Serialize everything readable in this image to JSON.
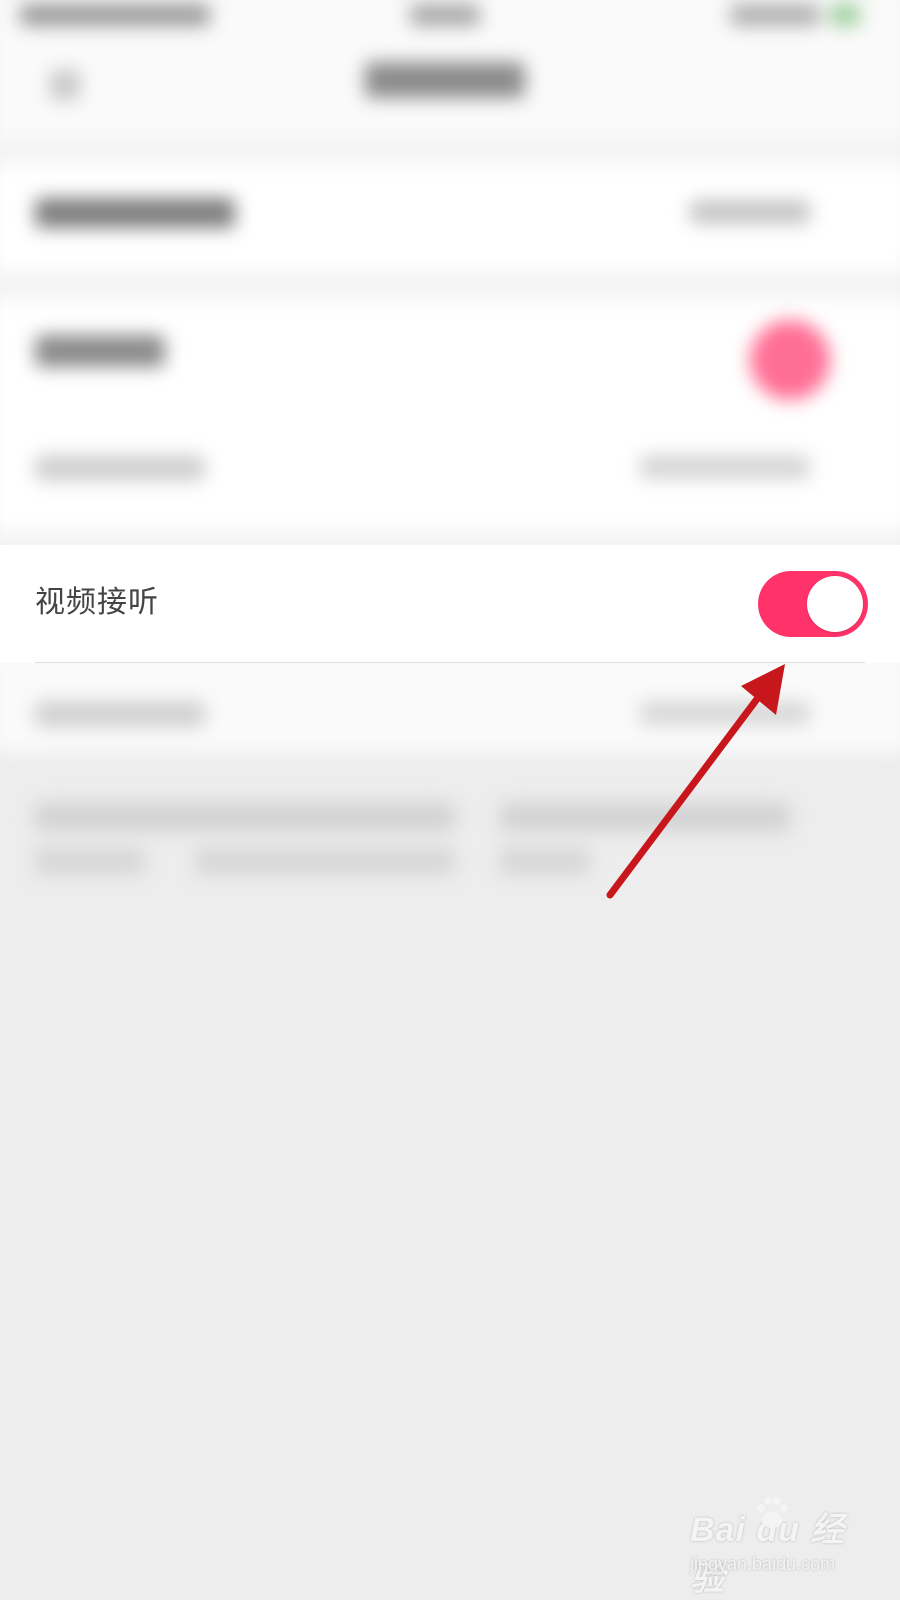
{
  "screen": {
    "background": "#ededed"
  },
  "setting_row": {
    "label": "视频接听",
    "toggle_on": true,
    "toggle_color": "#ff3369"
  },
  "annotation": {
    "arrow_color": "#c8161d"
  },
  "watermark": {
    "logo_text": "Bai du 经验",
    "url_text": "jingyan.baidu.com"
  }
}
